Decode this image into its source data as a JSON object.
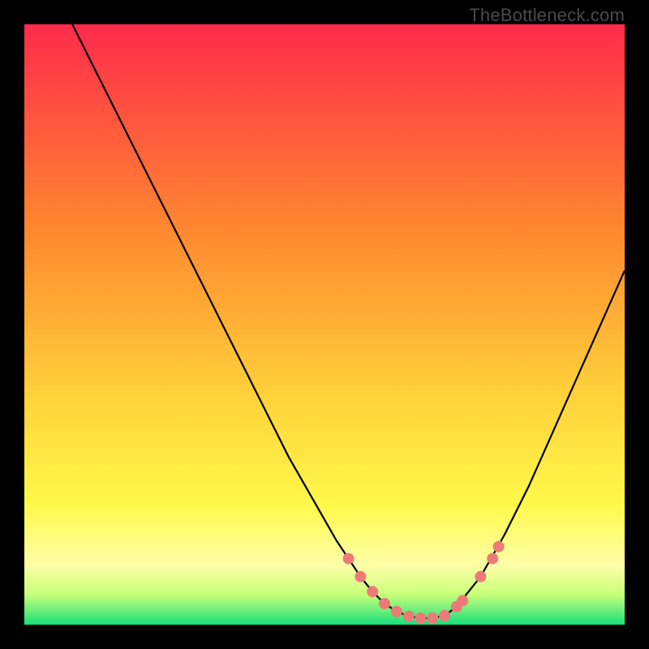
{
  "watermark": "TheBottleneck.com",
  "colors": {
    "gradient_top": "#ff2b4b",
    "gradient_mid1": "#ff6a2f",
    "gradient_mid2": "#ffd23a",
    "gradient_low": "#ffff66",
    "gradient_bottom": "#17e07a",
    "curve": "#000000",
    "marker": "#ee7a78",
    "frame": "#000000"
  },
  "chart_data": {
    "type": "line",
    "title": "",
    "xlabel": "",
    "ylabel": "",
    "xlim": [
      0,
      100
    ],
    "ylim": [
      0,
      100
    ],
    "series": [
      {
        "name": "curve",
        "x": [
          8,
          12,
          16,
          20,
          24,
          28,
          32,
          36,
          40,
          44,
          48,
          52,
          54,
          56,
          58,
          60,
          62,
          64,
          66,
          68,
          70,
          72,
          76,
          80,
          84,
          88,
          92,
          96,
          100
        ],
        "y": [
          100,
          92,
          84,
          76,
          68,
          60,
          52,
          44,
          36,
          28,
          21,
          14,
          11,
          8,
          5.5,
          3.5,
          2.2,
          1.4,
          1.1,
          1.1,
          1.5,
          3.0,
          8,
          15,
          23,
          32,
          41,
          50,
          59
        ]
      }
    ],
    "markers": {
      "name": "highlight-points",
      "x": [
        54,
        56,
        58,
        60,
        62,
        64,
        66,
        68,
        70,
        72,
        73,
        76,
        78,
        79
      ],
      "y": [
        11,
        8,
        5.5,
        3.5,
        2.2,
        1.4,
        1.1,
        1.1,
        1.5,
        3.0,
        4.0,
        8,
        11,
        13
      ]
    }
  }
}
